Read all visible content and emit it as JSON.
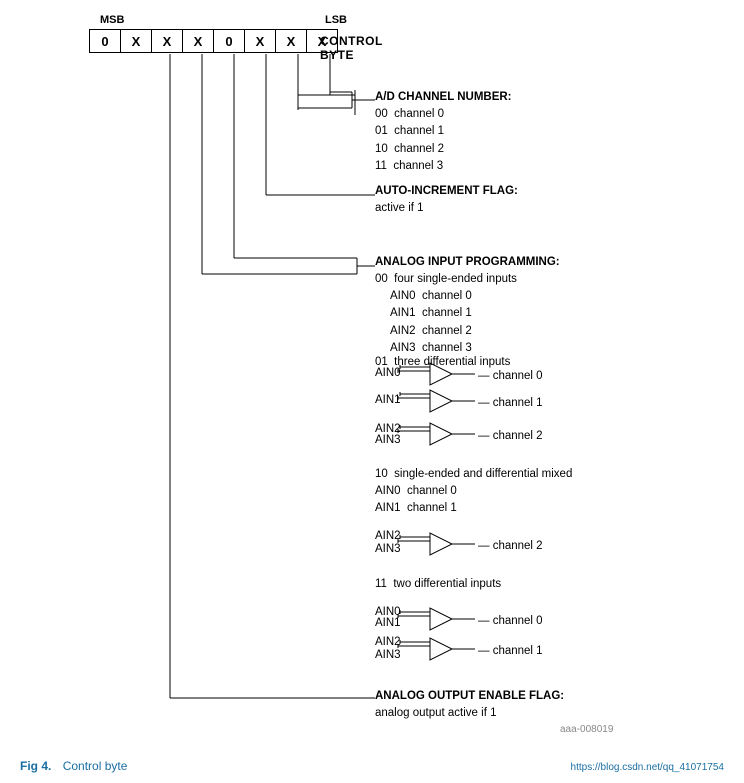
{
  "header": {
    "msb": "MSB",
    "lsb": "LSB",
    "control_byte_label": "CONTROL BYTE",
    "cells": [
      "0",
      "X",
      "X",
      "X",
      "0",
      "X",
      "X",
      "X"
    ]
  },
  "annotations": {
    "ad_channel": {
      "title": "A/D CHANNEL NUMBER:",
      "lines": [
        "00  channel 0",
        "01  channel 1",
        "10  channel 2",
        "11  channel 3"
      ]
    },
    "auto_increment": {
      "title": "AUTO-INCREMENT FLAG:",
      "line": "active if 1"
    },
    "analog_input": {
      "title": "ANALOG INPUT PROGRAMMING:",
      "code00": "00  four single-ended inputs",
      "ain0_ch0": "AIN0  channel 0",
      "ain1_ch1": "AIN1  channel 1",
      "ain2_ch2": "AIN2  channel 2",
      "ain3_ch3": "AIN3  channel 3",
      "code01": "01  three differential inputs",
      "ain0": "AIN0",
      "ain1": "AIN1",
      "ain2": "AIN2",
      "ain3_01": "AIN3",
      "ch0_01": "channel 0",
      "ch1_01": "channel 1",
      "ch2_01": "channel 2",
      "code10": "10  single-ended and differential mixed",
      "ain0_10": "AIN0  channel 0",
      "ain1_10": "AIN1  channel 1",
      "ain2_10": "AIN2",
      "ain3_10": "AIN3",
      "ch2_10": "channel 2",
      "code11": "11  two differential inputs",
      "ain0_11": "AIN0",
      "ain1_11": "AIN1",
      "ain2_11": "AIN2",
      "ain3_11": "AIN3",
      "ch0_11": "channel 0",
      "ch1_11": "channel 1"
    },
    "analog_output": {
      "title": "ANALOG OUTPUT ENABLE FLAG:",
      "line": "analog output active if 1"
    }
  },
  "footer": {
    "fig_num": "Fig 4.",
    "fig_title": "Control byte",
    "ref_code": "aaa-008019",
    "watermark": "https://blog.csdn.net/qq_41071754"
  }
}
